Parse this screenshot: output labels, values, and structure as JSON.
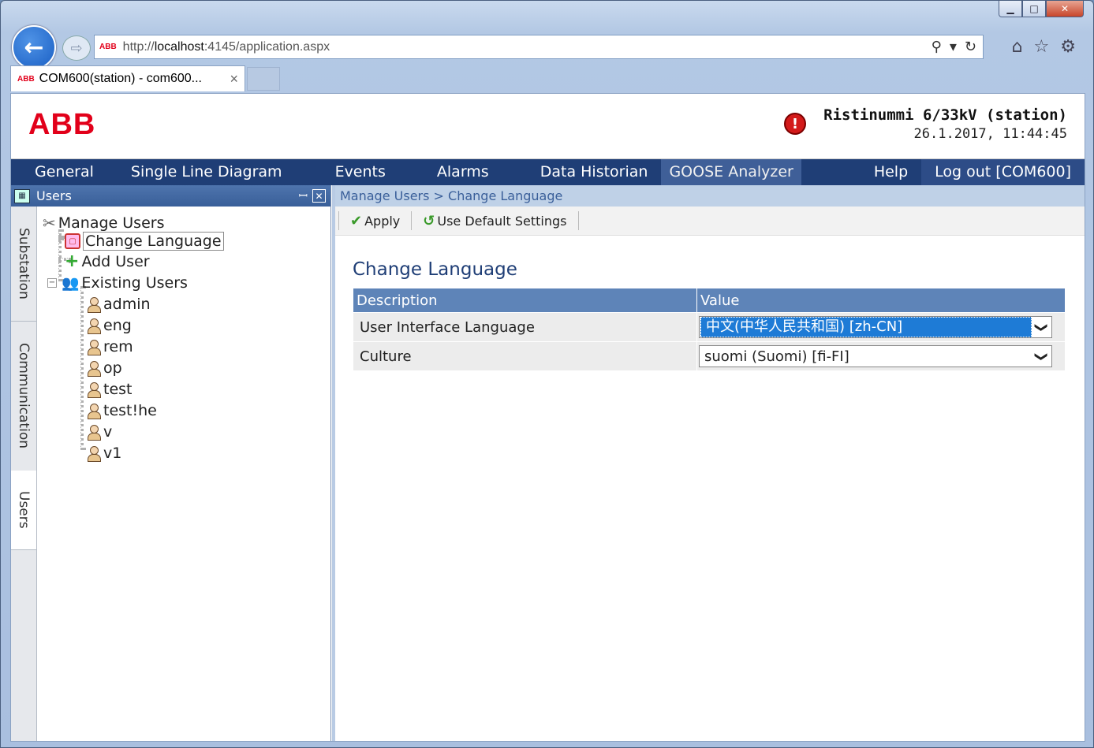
{
  "browser": {
    "address_logo": "ABB",
    "url_prefix": "http://",
    "url_host": "localhost",
    "url_rest": ":4145/application.aspx",
    "tab_logo": "ABB",
    "tab_title": "COM600(station) - com600...",
    "tab_close": "×"
  },
  "header": {
    "logo": "ABB",
    "alert_symbol": "!",
    "station_name": "Ristinummi 6/33kV (station)",
    "datetime": "26.1.2017, 11:44:45"
  },
  "menu": {
    "items": [
      "General",
      "Single Line Diagram",
      "Events",
      "Alarms",
      "Data Historian",
      "GOOSE Analyzer",
      "Help",
      "Log out [COM600]"
    ]
  },
  "sidebar": {
    "title": "Users",
    "vertical_tabs": [
      "Substation",
      "Communication",
      "Users"
    ],
    "tree": {
      "root": "Manage Users",
      "change_language": "Change Language",
      "add_user": "Add User",
      "existing_users": "Existing Users",
      "users": [
        "admin",
        "eng",
        "rem",
        "op",
        "test",
        "test!he",
        "v",
        "v1"
      ]
    }
  },
  "main": {
    "breadcrumb": "Manage Users > Change Language",
    "toolbar": {
      "apply": "Apply",
      "use_default": "Use Default Settings"
    },
    "section_title": "Change Language",
    "table": {
      "headers": [
        "Description",
        "Value"
      ],
      "rows": [
        {
          "description": "User Interface Language",
          "value": "中文(中华人民共和国) [zh-CN]"
        },
        {
          "description": "Culture",
          "value": "suomi (Suomi) [fi-FI]"
        }
      ]
    }
  },
  "colors": {
    "brand_red": "#e2001a",
    "menu_bg": "#1f3e76",
    "header_table": "#5e84b8",
    "selection": "#1e7bd6"
  }
}
